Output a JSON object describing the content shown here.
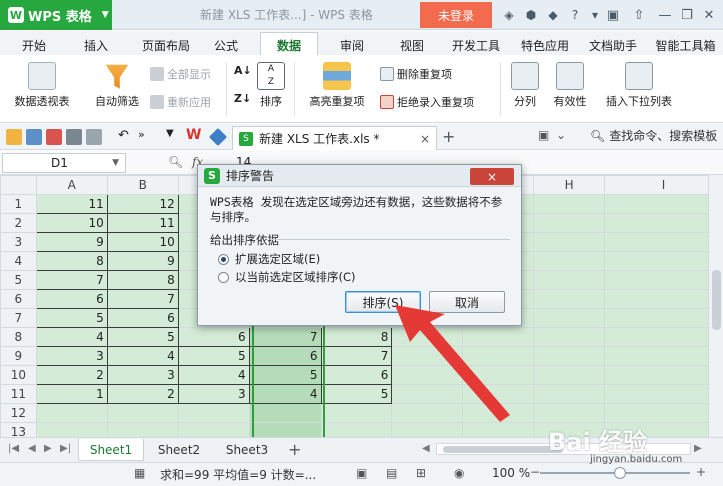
{
  "titlebar": {
    "app_name": "WPS 表格",
    "doc_title": "新建 XLS 工作表...] - WPS 表格",
    "login": "未登录"
  },
  "menu": [
    "开始",
    "插入",
    "页面布局",
    "公式",
    "数据",
    "审阅",
    "视图",
    "开发工具",
    "特色应用",
    "文档助手",
    "智能工具箱"
  ],
  "active_menu": "数据",
  "ribbon": {
    "pivot": "数据透视表",
    "autofilter": "自动筛选",
    "show_all": "全部显示",
    "reapply": "重新应用",
    "sort": "排序",
    "highlight_dup": "高亮重复项",
    "delete_dup": "删除重复项",
    "reject_dup": "拒绝录入重复项",
    "split": "分列",
    "validity": "有效性",
    "insert_dropdown": "插入下拉列表",
    "sort_asc_label": "A↓",
    "sort_desc_label": "Z↓"
  },
  "quickbar": {
    "doc_tab": "新建 XLS 工作表.xls *",
    "search": "查找命令、搜索模板"
  },
  "formula": {
    "name_box": "D1",
    "fx": "fx",
    "value": "14"
  },
  "grid": {
    "columns": [
      "A",
      "B",
      "C",
      "D",
      "E",
      "F",
      "G",
      "H",
      "I"
    ],
    "rows": [
      {
        "n": "1",
        "a": "11",
        "b": "12",
        "c": "",
        "d": "",
        "e": ""
      },
      {
        "n": "2",
        "a": "10",
        "b": "11",
        "c": "",
        "d": "",
        "e": ""
      },
      {
        "n": "3",
        "a": "9",
        "b": "10",
        "c": "",
        "d": "",
        "e": ""
      },
      {
        "n": "4",
        "a": "8",
        "b": "9",
        "c": "",
        "d": "",
        "e": ""
      },
      {
        "n": "5",
        "a": "7",
        "b": "8",
        "c": "",
        "d": "",
        "e": ""
      },
      {
        "n": "6",
        "a": "6",
        "b": "7",
        "c": "",
        "d": "",
        "e": ""
      },
      {
        "n": "7",
        "a": "5",
        "b": "6",
        "c": "",
        "d": "",
        "e": ""
      },
      {
        "n": "8",
        "a": "4",
        "b": "5",
        "c": "6",
        "d": "7",
        "e": "8"
      },
      {
        "n": "9",
        "a": "3",
        "b": "4",
        "c": "5",
        "d": "6",
        "e": "7"
      },
      {
        "n": "10",
        "a": "2",
        "b": "3",
        "c": "4",
        "d": "5",
        "e": "6"
      },
      {
        "n": "11",
        "a": "1",
        "b": "2",
        "c": "3",
        "d": "4",
        "e": "5"
      },
      {
        "n": "12",
        "a": "",
        "b": "",
        "c": "",
        "d": "",
        "e": ""
      },
      {
        "n": "13",
        "a": "",
        "b": "",
        "c": "",
        "d": "",
        "e": ""
      }
    ]
  },
  "sheets": [
    "Sheet1",
    "Sheet2",
    "Sheet3"
  ],
  "active_sheet": "Sheet1",
  "status": {
    "summary": "求和=99  平均值=9  计数=...",
    "zoom": "100 %"
  },
  "dialog": {
    "title": "排序警告",
    "close": "×",
    "message": "WPS表格 发现在选定区域旁边还有数据，这些数据将不参与排序。",
    "legend": "给出排序依据",
    "option1": "扩展选定区域(E)",
    "option2": "以当前选定区域排序(C)",
    "sort_btn": "排序(S)",
    "cancel_btn": "取消"
  },
  "watermark": "Bai 经验",
  "watermark_sub": "jingyan.baidu.com",
  "colors": {
    "brand_green": "#27a83f",
    "login_orange": "#f26b4f",
    "arrow_red": "#e53935",
    "cell_green": "#d4ecd7"
  }
}
